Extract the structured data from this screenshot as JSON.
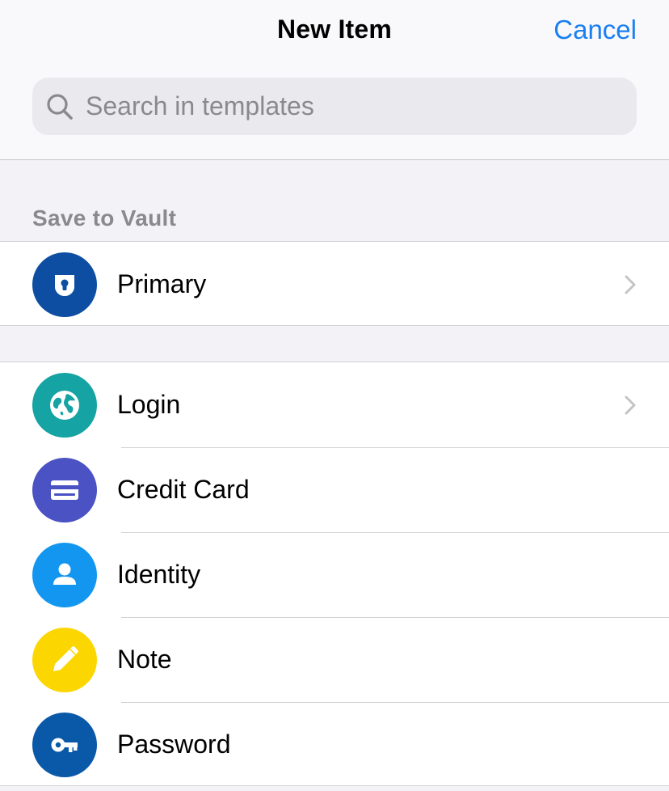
{
  "header": {
    "title": "New Item",
    "cancel_label": "Cancel",
    "search_placeholder": "Search in templates"
  },
  "vault": {
    "section_label": "Save to Vault",
    "item": {
      "label": "Primary",
      "icon": "vault-icon",
      "color": "#0d4ea3"
    }
  },
  "templates": [
    {
      "label": "Login",
      "icon": "globe-icon",
      "color": "#15a3a3"
    },
    {
      "label": "Credit Card",
      "icon": "credit-card-icon",
      "color": "#4a52c4"
    },
    {
      "label": "Identity",
      "icon": "person-icon",
      "color": "#1396f0"
    },
    {
      "label": "Note",
      "icon": "pencil-icon",
      "color": "#fcd600"
    },
    {
      "label": "Password",
      "icon": "key-icon",
      "color": "#0a58a8"
    }
  ],
  "colors": {
    "accent": "#1a7ff0",
    "secondary_text": "#8a8a8e"
  }
}
